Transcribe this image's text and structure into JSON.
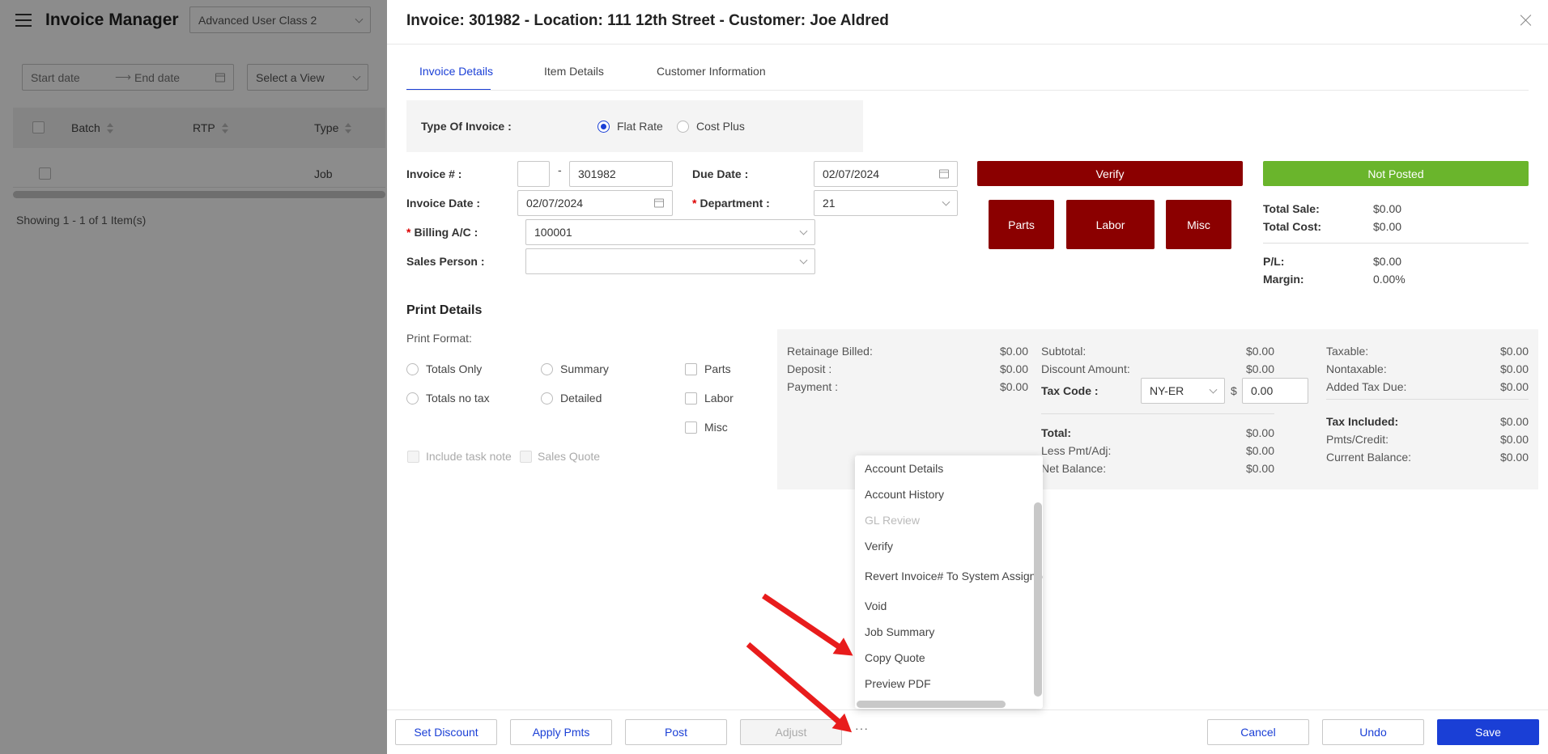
{
  "app": {
    "title": "Invoice Manager",
    "class_select": "Advanced User Class 2"
  },
  "filters": {
    "start_date": "Start date",
    "end_date": "End date",
    "view_select": "Select a View"
  },
  "grid": {
    "columns": [
      "Batch",
      "RTP",
      "Type"
    ],
    "row": {
      "type": "Job"
    },
    "footer": "Showing 1 - 1 of 1 Item(s)"
  },
  "panel": {
    "title": "Invoice: 301982 - Location: 111 12th Street - Customer: Joe Aldred",
    "tabs": [
      "Invoice Details",
      "Item Details",
      "Customer Information"
    ],
    "type_of_invoice": {
      "label": "Type Of Invoice :",
      "options": [
        "Flat Rate",
        "Cost Plus"
      ],
      "selected": "Flat Rate"
    },
    "fields": {
      "invoice_no_label": "Invoice # :",
      "invoice_prefix": "",
      "invoice_sep": "-",
      "invoice_no": "301982",
      "invoice_date_label": "Invoice Date :",
      "invoice_date": "02/07/2024",
      "billing_label": "Billing A/C :",
      "billing_value": "100001",
      "sales_person_label": "Sales Person :",
      "sales_person_value": "",
      "due_date_label": "Due Date :",
      "due_date": "02/07/2024",
      "department_label": "Department :",
      "department_value": "21"
    },
    "buttons": {
      "verify": "Verify",
      "parts": "Parts",
      "labor": "Labor",
      "misc": "Misc",
      "status": "Not Posted"
    },
    "summary": {
      "total_sale_label": "Total Sale:",
      "total_sale": "$0.00",
      "total_cost_label": "Total Cost:",
      "total_cost": "$0.00",
      "pl_label": "P/L:",
      "pl": "$0.00",
      "margin_label": "Margin:",
      "margin": "0.00%"
    },
    "print": {
      "title": "Print Details",
      "format_label": "Print Format:",
      "radios": [
        "Totals Only",
        "Totals no tax",
        "Summary",
        "Detailed"
      ],
      "checks": [
        "Parts",
        "Labor",
        "Misc"
      ],
      "include_task_note": "Include task note",
      "sales_quote": "Sales Quote"
    },
    "totals": {
      "retainage_label": "Retainage Billed:",
      "retainage": "$0.00",
      "deposit_label": "Deposit :",
      "deposit": "$0.00",
      "payment_label": "Payment :",
      "payment": "$0.00",
      "subtotal_label": "Subtotal:",
      "subtotal": "$0.00",
      "discount_label": "Discount Amount:",
      "discount": "$0.00",
      "tax_code_label": "Tax Code :",
      "tax_code": "NY-ER",
      "tax_currency": "$",
      "tax_amount": "0.00",
      "total_label": "Total:",
      "total": "$0.00",
      "less_pmt_label": "Less Pmt/Adj:",
      "less_pmt": "$0.00",
      "net_balance_label": "Net Balance:",
      "net_balance": "$0.00",
      "taxable_label": "Taxable:",
      "taxable": "$0.00",
      "nontaxable_label": "Nontaxable:",
      "nontaxable": "$0.00",
      "added_tax_label": "Added Tax Due:",
      "added_tax": "$0.00",
      "tax_included_label": "Tax Included:",
      "tax_included": "$0.00",
      "pmts_credit_label": "Pmts/Credit:",
      "pmts_credit": "$0.00",
      "current_balance_label": "Current Balance:",
      "current_balance": "$0.00"
    },
    "menu": [
      "Account Details",
      "Account History",
      "GL Review",
      "Verify",
      "Revert Invoice# To System Assigned",
      "Void",
      "Job Summary",
      "Copy Quote",
      "Preview PDF"
    ],
    "footer": {
      "set_discount": "Set Discount",
      "apply_pmts": "Apply Pmts",
      "post": "Post",
      "adjust": "Adjust",
      "more": "···",
      "cancel": "Cancel",
      "undo": "Undo",
      "save": "Save"
    }
  },
  "colors": {
    "accent": "#1a3fd6",
    "dark_red": "#8b0000",
    "green": "#6ab52c",
    "arrow": "#e81c1c"
  }
}
